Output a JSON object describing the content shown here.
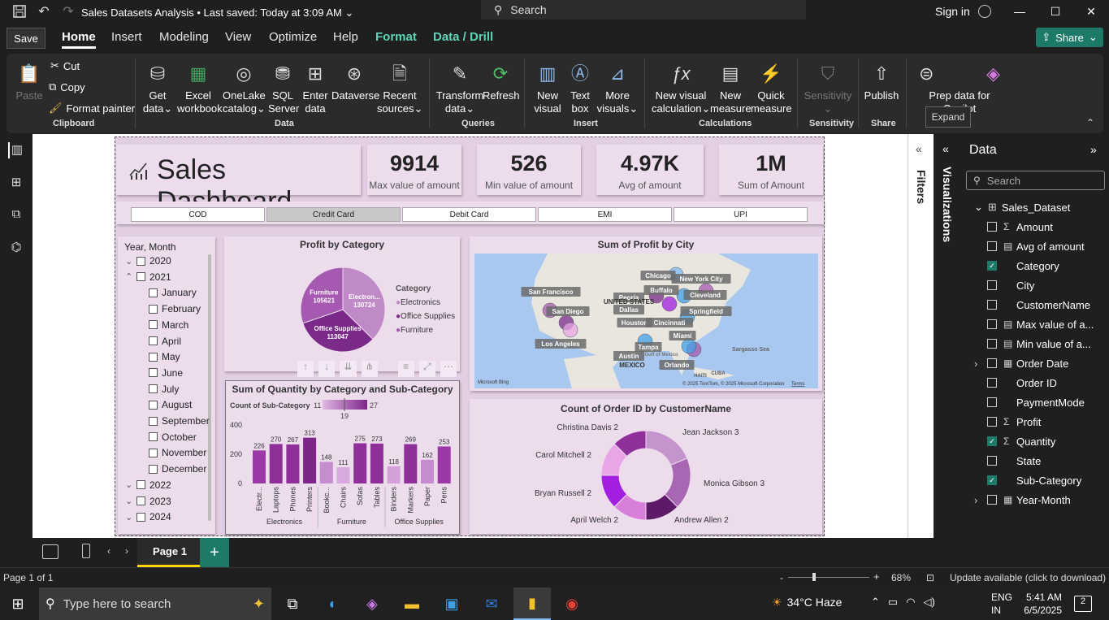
{
  "window": {
    "doc_title": "Sales Datasets Analysis",
    "saved_status": "• Last saved: Today at 3:09 AM",
    "search_placeholder": "Search",
    "sign_in": "Sign in",
    "save_tooltip": "Save",
    "expand_tooltip": "Expand"
  },
  "menu": {
    "tabs": [
      "Home",
      "Insert",
      "Modeling",
      "View",
      "Optimize",
      "Help",
      "Format",
      "Data / Drill"
    ],
    "share": "Share"
  },
  "ribbon": {
    "paste": "Paste",
    "cut": "Cut",
    "copy": "Copy",
    "format_painter": "Format painter",
    "clipboard": "Clipboard",
    "get_data": [
      "Get",
      "data"
    ],
    "excel": [
      "Excel",
      "workbook"
    ],
    "onelake": [
      "OneLake",
      "catalog"
    ],
    "sql": [
      "SQL",
      "Server"
    ],
    "enter_data": [
      "Enter",
      "data"
    ],
    "dataverse": "Dataverse",
    "recent_sources": [
      "Recent",
      "sources"
    ],
    "data_group": "Data",
    "transform": [
      "Transform",
      "data"
    ],
    "refresh": "Refresh",
    "queries_group": "Queries",
    "new_visual": [
      "New",
      "visual"
    ],
    "text_box": [
      "Text",
      "box"
    ],
    "more_visuals": [
      "More",
      "visuals"
    ],
    "insert_group": "Insert",
    "new_visual_calc": [
      "New visual",
      "calculation"
    ],
    "new_measure": [
      "New",
      "measure"
    ],
    "quick_measure": [
      "Quick",
      "measure"
    ],
    "calc_group": "Calculations",
    "sensitivity": "Sensitivity",
    "sensitivity_group": "Sensitivity",
    "publish": "Publish",
    "share_group": "Share",
    "prep_copilot": "Prep data for Copilot"
  },
  "kpis": [
    {
      "value": "9914",
      "label": "Max value of amount"
    },
    {
      "value": "526",
      "label": "Min value of amount"
    },
    {
      "value": "4.97K",
      "label": "Avg of amount"
    },
    {
      "value": "1M",
      "label": "Sum of Amount"
    }
  ],
  "dashboard_title": "Sales Dashboard",
  "payment_slicer": {
    "options": [
      "COD",
      "Credit Card",
      "Debit Card",
      "EMI",
      "UPI"
    ],
    "selected": "Credit Card"
  },
  "date_slicer": {
    "title": "Year, Month",
    "items": [
      "2020",
      "2021",
      "January",
      "February",
      "March",
      "April",
      "May",
      "June",
      "July",
      "August",
      "September",
      "October",
      "November",
      "December",
      "2022",
      "2023",
      "2024"
    ]
  },
  "pie": {
    "title": "Profit by Category",
    "legend_title": "Category",
    "slices": [
      {
        "name": "Electronics",
        "label": "Electron...",
        "value": 130724,
        "color": "#c08ac8"
      },
      {
        "name": "Office Supplies",
        "label": "Office Supplies",
        "value": 113047,
        "color": "#7b2a8a"
      },
      {
        "name": "Furniture",
        "label": "Furniture",
        "value": 105621,
        "color": "#a659b0"
      }
    ]
  },
  "map": {
    "title": "Sum of Profit by City",
    "cities": [
      "San Francisco",
      "San Diego",
      "Los Angeles",
      "Chicago",
      "New York City",
      "Peoria",
      "Buffalo",
      "Cleveland",
      "Dallas",
      "Springfield",
      "Houston",
      "Cincinnati",
      "Miami",
      "Tampa",
      "Austin",
      "Orlando"
    ],
    "labels": [
      "UNITED STATES",
      "MEXICO",
      "Sargasso Sea",
      "CUBA",
      "HAITI",
      "Gulf of Mexico"
    ],
    "credit": "© 2025 TomTom, © 2025 Microsoft Corporation",
    "terms": "Terms",
    "brand": "Microsoft Bing"
  },
  "chart_data": [
    {
      "type": "bar",
      "title": "Sum of Quantity by Category and Sub-Category",
      "legend_title": "Count of Sub-Category",
      "legend_min": "11",
      "legend_mid": "19",
      "legend_max": "27",
      "ylim": [
        0,
        400
      ],
      "yticks": [
        "400",
        "200",
        "0"
      ],
      "categories": [
        "Electr...",
        "Laptops",
        "Phones",
        "Printers",
        "Bookc...",
        "Chairs",
        "Sofas",
        "Tables",
        "Binders",
        "Markers",
        "Paper",
        "Pens"
      ],
      "values": [
        226,
        270,
        267,
        313,
        148,
        111,
        275,
        273,
        118,
        269,
        162,
        253
      ],
      "groups": [
        {
          "name": "Electronics",
          "count": 4
        },
        {
          "name": "Furniture",
          "count": 4
        },
        {
          "name": "Office Supplies",
          "count": 4
        }
      ],
      "colors": [
        "#9b3aa6",
        "#8e2f9a",
        "#8e2f9a",
        "#7d2589",
        "#c68ccf",
        "#d9a9df",
        "#8e2f9a",
        "#8e2f9a",
        "#d3a0d9",
        "#8e2f9a",
        "#c68ccf",
        "#9b3aa6"
      ]
    },
    {
      "type": "pie",
      "title": "Count of Order ID by CustomerName",
      "categories": [
        "Jean Jackson",
        "Monica Gibson",
        "Andrew Allen",
        "April Welch",
        "Bryan Russell",
        "Carol Mitchell",
        "Christina Davis"
      ],
      "values": [
        3,
        3,
        2,
        2,
        2,
        2,
        2
      ],
      "colors": [
        "#c594cc",
        "#a867b2",
        "#5c1a68",
        "#d87fd9",
        "#a21ee0",
        "#e8a6e8",
        "#8e2f9a"
      ]
    }
  ],
  "panes": {
    "filters": "Filters",
    "visualizations": "Visualizations",
    "data": "Data",
    "search": "Search",
    "dataset": "Sales_Dataset",
    "fields": [
      {
        "name": "Amount",
        "type": "sigma",
        "checked": false,
        "expand": false
      },
      {
        "name": "Avg of amount",
        "type": "calc",
        "checked": false,
        "expand": false
      },
      {
        "name": "Category",
        "type": "",
        "checked": true,
        "expand": false
      },
      {
        "name": "City",
        "type": "",
        "checked": false,
        "expand": false
      },
      {
        "name": "CustomerName",
        "type": "",
        "checked": false,
        "expand": false
      },
      {
        "name": "Max value of a...",
        "type": "calc",
        "checked": false,
        "expand": false
      },
      {
        "name": "Min value of a...",
        "type": "calc",
        "checked": false,
        "expand": false
      },
      {
        "name": "Order Date",
        "type": "table",
        "checked": false,
        "expand": true
      },
      {
        "name": "Order ID",
        "type": "",
        "checked": false,
        "expand": false
      },
      {
        "name": "PaymentMode",
        "type": "",
        "checked": false,
        "expand": false
      },
      {
        "name": "Profit",
        "type": "sigma",
        "checked": false,
        "expand": false
      },
      {
        "name": "Quantity",
        "type": "sigma",
        "checked": true,
        "expand": false
      },
      {
        "name": "State",
        "type": "",
        "checked": false,
        "expand": false
      },
      {
        "name": "Sub-Category",
        "type": "",
        "checked": true,
        "expand": false
      },
      {
        "name": "Year-Month",
        "type": "table",
        "checked": false,
        "expand": true
      }
    ]
  },
  "pages": {
    "current": "Page 1",
    "status": "Page 1 of 1",
    "zoom": "68%",
    "update": "Update available (click to download)"
  },
  "taskbar": {
    "search": "Type here to search",
    "weather": "34°C  Haze",
    "lang1": "ENG",
    "lang2": "IN",
    "time": "5:41 AM",
    "date": "6/5/2025",
    "notif": "2"
  }
}
